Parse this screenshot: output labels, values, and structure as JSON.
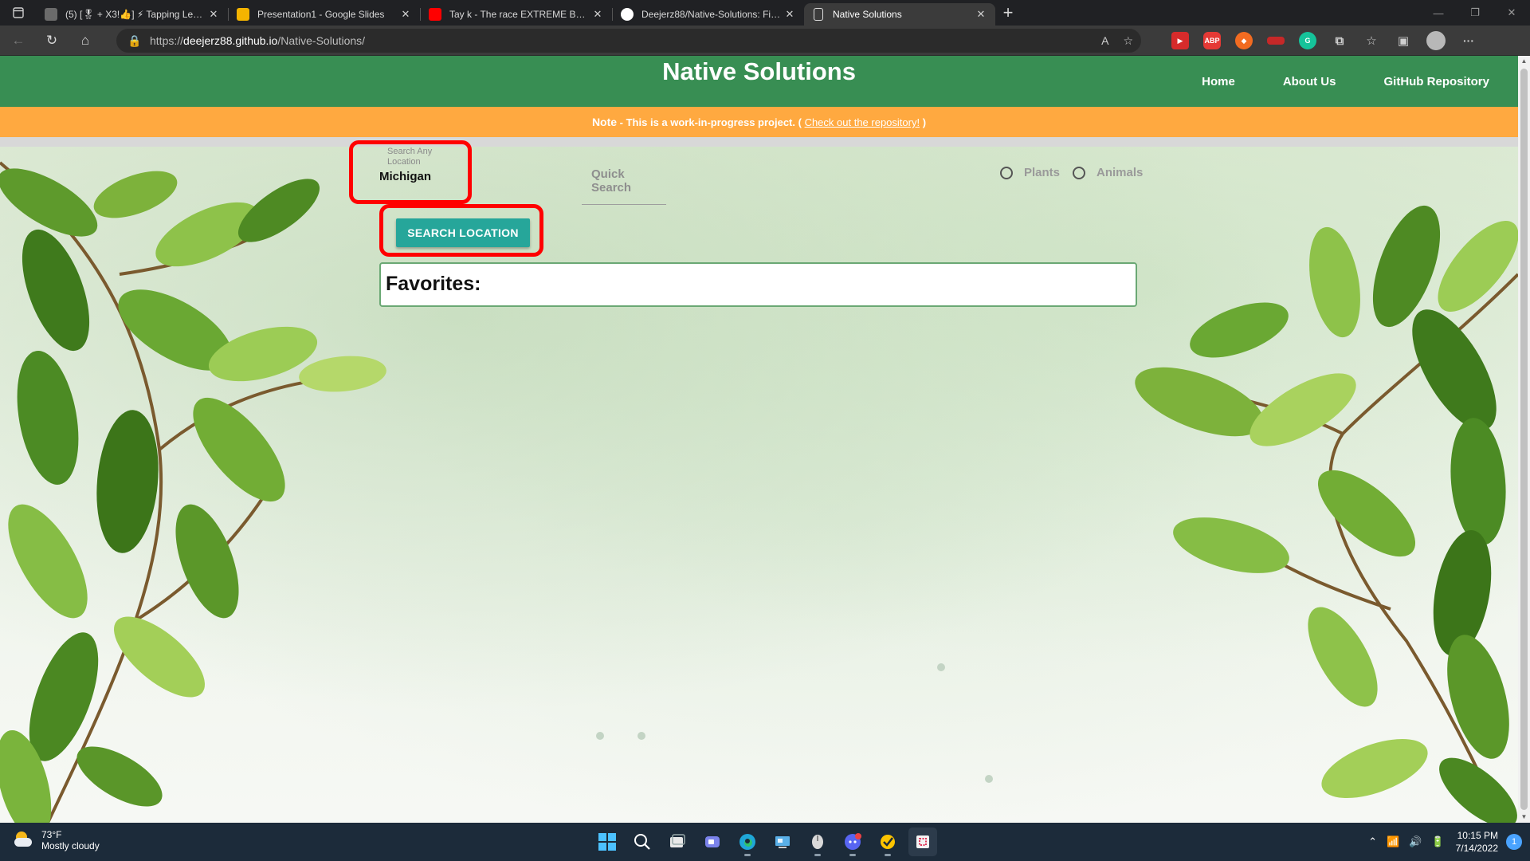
{
  "browser": {
    "tabs": [
      {
        "title": "(5) [🎖 + X3!👍] ⚡ Tapping Legends",
        "color": "#6b6b6b"
      },
      {
        "title": "Presentation1 - Google Slides",
        "color": "#f4b400"
      },
      {
        "title": "Tay k - The race EXTREME BASS BOOSTED",
        "color": "#ff0000"
      },
      {
        "title": "Deejerz88/Native-Solutions: Find native plants",
        "color": "#ffffff"
      },
      {
        "title": "Native Solutions",
        "color": "#ffffff"
      }
    ],
    "url_prefix": "https://",
    "url_host": "deejerz88.github.io",
    "url_path": "/Native-Solutions/",
    "new_tab_label": "+",
    "read_aloud": "A",
    "more_label": "···"
  },
  "site": {
    "title": "Native Solutions",
    "nav": [
      "Home",
      "About Us",
      "GitHub Repository"
    ],
    "note_label": "Note",
    "note_text": " - This is a work-in-progress project. ( ",
    "note_link": "Check out the repository!",
    "note_end": " )"
  },
  "search": {
    "label": "Search Any Location",
    "value": "Michigan",
    "quick_search": "Quick Search",
    "radio_plants": "Plants",
    "radio_animals": "Animals",
    "button": "SEARCH LOCATION",
    "favorites_title": "Favorites:"
  },
  "taskbar": {
    "temp": "73°F",
    "weather": "Mostly cloudy",
    "time": "10:15 PM",
    "date": "7/14/2022",
    "notifications": "1"
  },
  "colors": {
    "header_green": "#388e53",
    "note_orange": "#ffa940",
    "button_teal": "#26a69a",
    "highlight_red": "#ff0000"
  }
}
